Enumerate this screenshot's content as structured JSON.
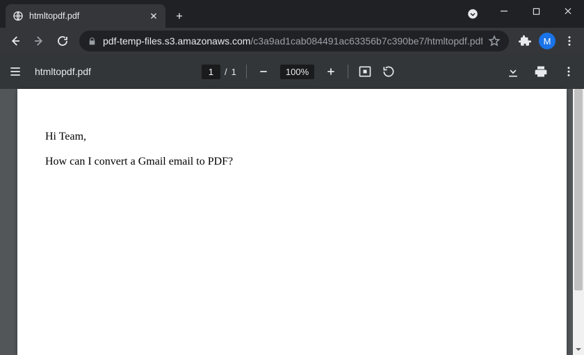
{
  "browser": {
    "tab_title": "htmltopdf.pdf",
    "url_host": "pdf-temp-files.s3.amazonaws.com",
    "url_path": "/c3a9ad1cab084491ac63356b7c390be7/htmltopdf.pdf",
    "avatar_letter": "M"
  },
  "pdf": {
    "doc_name": "htmltopdf.pdf",
    "current_page": "1",
    "page_sep": "/",
    "total_pages": "1",
    "zoom": "100%"
  },
  "document": {
    "line1": "Hi Team,",
    "line2": "How can I convert a Gmail email to PDF?"
  }
}
